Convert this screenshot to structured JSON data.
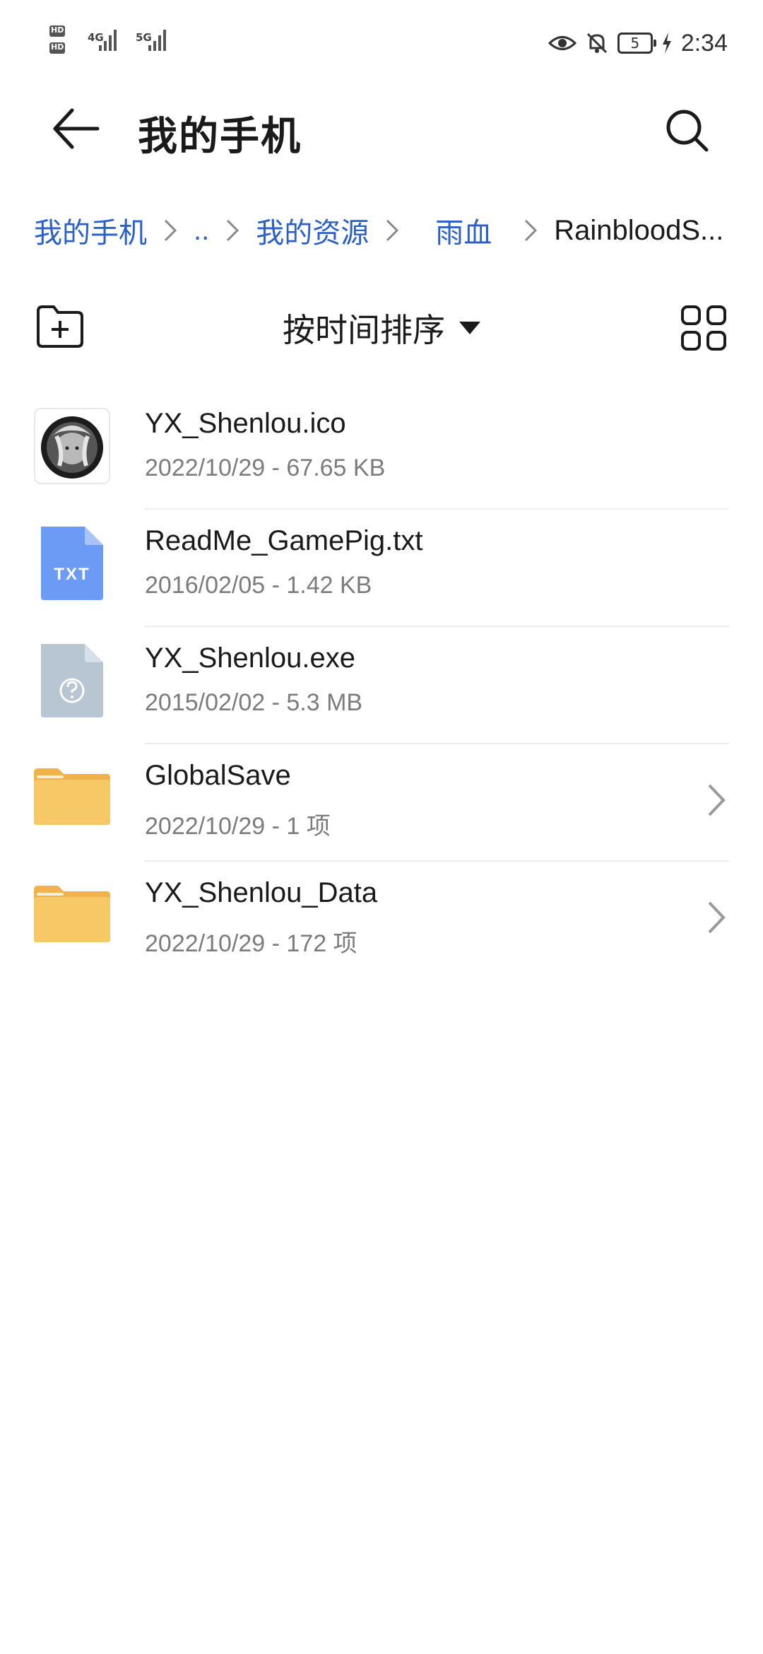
{
  "status_bar": {
    "sim1": "HD 1",
    "sim2": "HD 2",
    "net1": "4G",
    "net2": "5G",
    "battery": "5",
    "time": "2:34"
  },
  "header": {
    "title": "我的手机",
    "back_icon": "arrow-left-icon",
    "search_icon": "search-icon"
  },
  "breadcrumb": {
    "items": [
      "我的手机",
      "..",
      "我的资源",
      "雨血"
    ],
    "current": "RainbloodS..."
  },
  "toolbar": {
    "sort_label": "按时间排序",
    "new_folder_icon": "new-folder-icon",
    "view_icon": "grid-view-icon"
  },
  "files": [
    {
      "name": "YX_Shenlou.ico",
      "meta": "2022/10/29 - 67.65 KB",
      "kind": "image"
    },
    {
      "name": "ReadMe_GamePig.txt",
      "meta": "2016/02/05 - 1.42 KB",
      "kind": "txt",
      "badge": "TXT"
    },
    {
      "name": "YX_Shenlou.exe",
      "meta": "2015/02/02 - 5.3 MB",
      "kind": "unknown"
    },
    {
      "name": "GlobalSave",
      "meta": "2022/10/29 - 1 项",
      "kind": "folder"
    },
    {
      "name": "YX_Shenlou_Data",
      "meta": "2022/10/29 - 172 项",
      "kind": "folder"
    }
  ],
  "colors": {
    "link": "#2a60c8",
    "txt_icon": "#6b9bf4",
    "unknown_icon": "#b8c5d3",
    "folder": "#f7c966",
    "folder_tab": "#f0b24a"
  }
}
